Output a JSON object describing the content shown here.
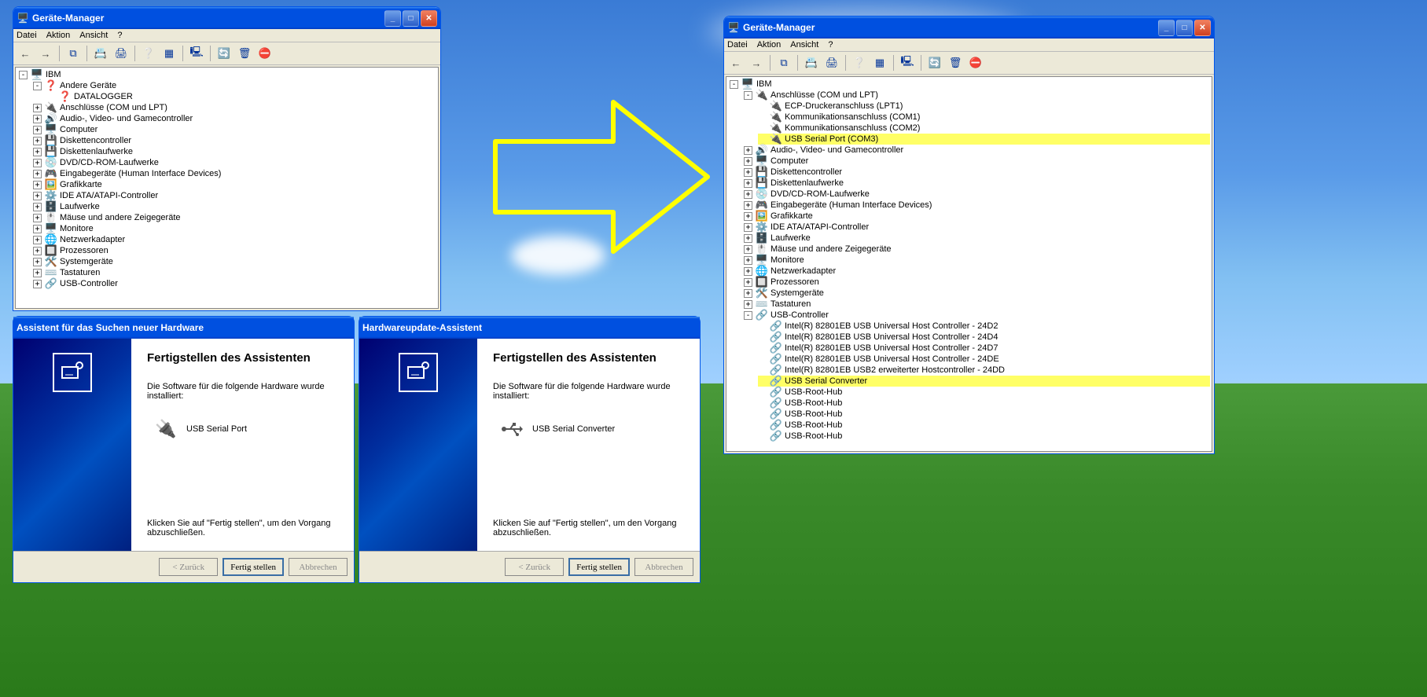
{
  "devmgr_left": {
    "title": "Geräte-Manager",
    "menu": [
      "Datei",
      "Aktion",
      "Ansicht",
      "?"
    ],
    "root": "IBM",
    "categories": [
      {
        "label": "Andere Geräte",
        "expander": "-",
        "icon": "question",
        "children": [
          {
            "label": "DATALOGGER",
            "icon": "question"
          }
        ]
      },
      {
        "label": "Anschlüsse (COM und LPT)",
        "expander": "+",
        "icon": "port"
      },
      {
        "label": "Audio-, Video- und Gamecontroller",
        "expander": "+",
        "icon": "audio"
      },
      {
        "label": "Computer",
        "expander": "+",
        "icon": "computer"
      },
      {
        "label": "Diskettencontroller",
        "expander": "+",
        "icon": "floppy"
      },
      {
        "label": "Diskettenlaufwerke",
        "expander": "+",
        "icon": "floppy"
      },
      {
        "label": "DVD/CD-ROM-Laufwerke",
        "expander": "+",
        "icon": "cd"
      },
      {
        "label": "Eingabegeräte (Human Interface Devices)",
        "expander": "+",
        "icon": "hid"
      },
      {
        "label": "Grafikkarte",
        "expander": "+",
        "icon": "display"
      },
      {
        "label": "IDE ATA/ATAPI-Controller",
        "expander": "+",
        "icon": "ide"
      },
      {
        "label": "Laufwerke",
        "expander": "+",
        "icon": "drive"
      },
      {
        "label": "Mäuse und andere Zeigegeräte",
        "expander": "+",
        "icon": "mouse"
      },
      {
        "label": "Monitore",
        "expander": "+",
        "icon": "monitor"
      },
      {
        "label": "Netzwerkadapter",
        "expander": "+",
        "icon": "net"
      },
      {
        "label": "Prozessoren",
        "expander": "+",
        "icon": "cpu"
      },
      {
        "label": "Systemgeräte",
        "expander": "+",
        "icon": "system"
      },
      {
        "label": "Tastaturen",
        "expander": "+",
        "icon": "keyboard"
      },
      {
        "label": "USB-Controller",
        "expander": "+",
        "icon": "usb"
      }
    ]
  },
  "devmgr_right": {
    "title": "Geräte-Manager",
    "menu": [
      "Datei",
      "Aktion",
      "Ansicht",
      "?"
    ],
    "root": "IBM",
    "categories": [
      {
        "label": "Anschlüsse (COM und LPT)",
        "expander": "-",
        "icon": "port",
        "children": [
          {
            "label": "ECP-Druckeranschluss (LPT1)",
            "icon": "port"
          },
          {
            "label": "Kommunikationsanschluss (COM1)",
            "icon": "port"
          },
          {
            "label": "Kommunikationsanschluss (COM2)",
            "icon": "port"
          },
          {
            "label": "USB Serial Port (COM3)",
            "icon": "port",
            "highlight": true
          }
        ]
      },
      {
        "label": "Audio-, Video- und Gamecontroller",
        "expander": "+",
        "icon": "audio"
      },
      {
        "label": "Computer",
        "expander": "+",
        "icon": "computer"
      },
      {
        "label": "Diskettencontroller",
        "expander": "+",
        "icon": "floppy"
      },
      {
        "label": "Diskettenlaufwerke",
        "expander": "+",
        "icon": "floppy"
      },
      {
        "label": "DVD/CD-ROM-Laufwerke",
        "expander": "+",
        "icon": "cd"
      },
      {
        "label": "Eingabegeräte (Human Interface Devices)",
        "expander": "+",
        "icon": "hid"
      },
      {
        "label": "Grafikkarte",
        "expander": "+",
        "icon": "display"
      },
      {
        "label": "IDE ATA/ATAPI-Controller",
        "expander": "+",
        "icon": "ide"
      },
      {
        "label": "Laufwerke",
        "expander": "+",
        "icon": "drive"
      },
      {
        "label": "Mäuse und andere Zeigegeräte",
        "expander": "+",
        "icon": "mouse"
      },
      {
        "label": "Monitore",
        "expander": "+",
        "icon": "monitor"
      },
      {
        "label": "Netzwerkadapter",
        "expander": "+",
        "icon": "net"
      },
      {
        "label": "Prozessoren",
        "expander": "+",
        "icon": "cpu"
      },
      {
        "label": "Systemgeräte",
        "expander": "+",
        "icon": "system"
      },
      {
        "label": "Tastaturen",
        "expander": "+",
        "icon": "keyboard"
      },
      {
        "label": "USB-Controller",
        "expander": "-",
        "icon": "usb",
        "children": [
          {
            "label": "Intel(R) 82801EB USB Universal Host Controller - 24D2",
            "icon": "usb"
          },
          {
            "label": "Intel(R) 82801EB USB Universal Host Controller - 24D4",
            "icon": "usb"
          },
          {
            "label": "Intel(R) 82801EB USB Universal Host Controller - 24D7",
            "icon": "usb"
          },
          {
            "label": "Intel(R) 82801EB USB Universal Host Controller - 24DE",
            "icon": "usb"
          },
          {
            "label": "Intel(R) 82801EB USB2 erweiterter Hostcontroller - 24DD",
            "icon": "usb"
          },
          {
            "label": "USB Serial Converter",
            "icon": "usb",
            "highlight": true
          },
          {
            "label": "USB-Root-Hub",
            "icon": "usb"
          },
          {
            "label": "USB-Root-Hub",
            "icon": "usb"
          },
          {
            "label": "USB-Root-Hub",
            "icon": "usb"
          },
          {
            "label": "USB-Root-Hub",
            "icon": "usb"
          },
          {
            "label": "USB-Root-Hub",
            "icon": "usb"
          }
        ]
      }
    ]
  },
  "wizards": [
    {
      "title": "Assistent für das Suchen neuer Hardware",
      "heading": "Fertigstellen des Assistenten",
      "sub": "Die Software für die folgende Hardware wurde installiert:",
      "device_label": "USB Serial Port",
      "device_icon": "port",
      "bottom": "Klicken Sie auf \"Fertig stellen\", um den Vorgang abzuschließen.",
      "buttons": {
        "back": "< Zurück",
        "finish": "Fertig stellen",
        "cancel": "Abbrechen"
      }
    },
    {
      "title": "Hardwareupdate-Assistent",
      "heading": "Fertigstellen des Assistenten",
      "sub": "Die Software für die folgende Hardware wurde installiert:",
      "device_label": "USB Serial Converter",
      "device_icon": "usb",
      "bottom": "Klicken Sie auf \"Fertig stellen\", um den Vorgang abzuschließen.",
      "buttons": {
        "back": "< Zurück",
        "finish": "Fertig stellen",
        "cancel": "Abbrechen"
      }
    }
  ]
}
